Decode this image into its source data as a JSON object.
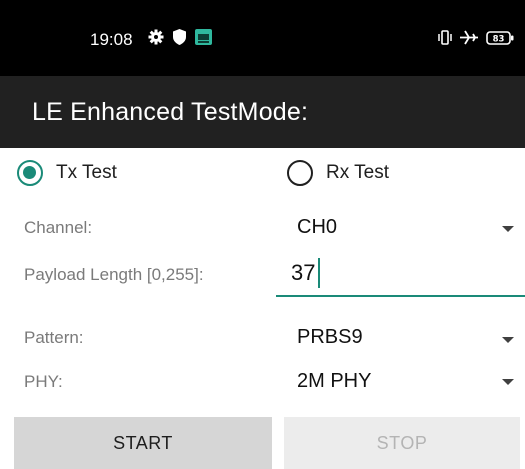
{
  "status_bar": {
    "time": "19:08",
    "left_icons": [
      "gear-icon",
      "shield-icon",
      "app-notification-icon"
    ],
    "right_icons": [
      "vibrate-icon",
      "airplane-icon",
      "battery-icon"
    ],
    "battery_level": "83"
  },
  "app_bar": {
    "title": "LE Enhanced TestMode:"
  },
  "mode": {
    "tx_label": "Tx Test",
    "rx_label": "Rx Test",
    "selected": "Tx Test"
  },
  "form": {
    "channel_label": "Channel:",
    "channel_value": "CH0",
    "payload_label": "Payload Length [0,255]:",
    "payload_value": "37",
    "pattern_label": "Pattern:",
    "pattern_value": "PRBS9",
    "phy_label": "PHY:",
    "phy_value": "2M PHY"
  },
  "buttons": {
    "start_label": "START",
    "stop_label": "STOP"
  },
  "colors": {
    "accent": "#1a8a78",
    "app_bar": "#212121",
    "status_bar": "#000000"
  }
}
